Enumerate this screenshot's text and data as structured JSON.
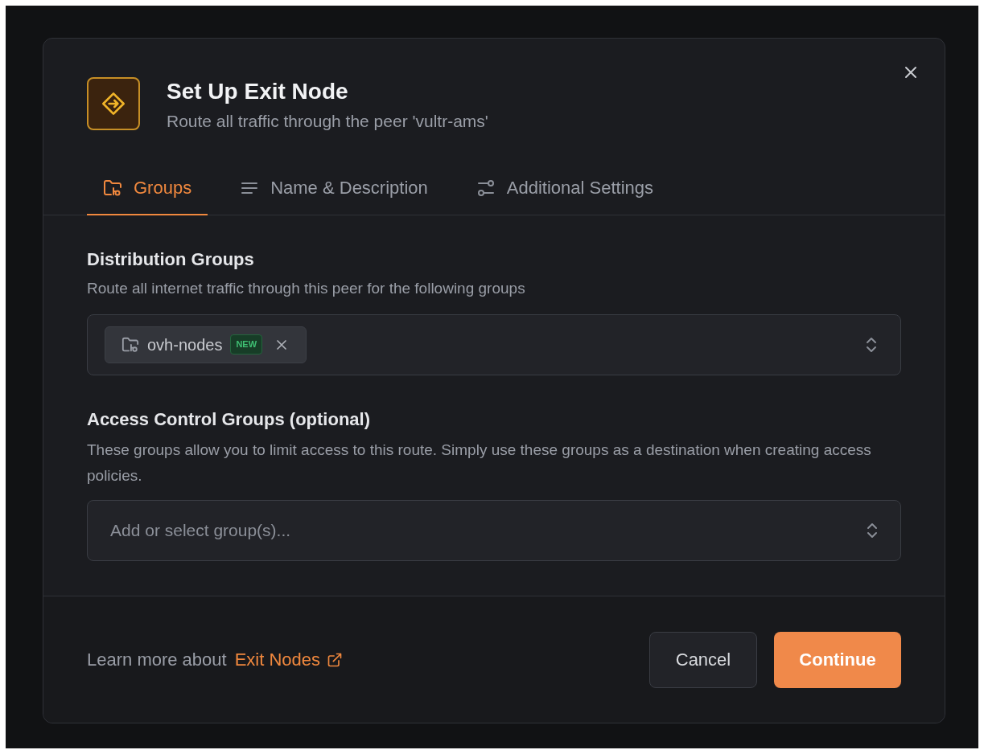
{
  "dialog": {
    "title": "Set Up Exit Node",
    "subtitle": "Route all traffic through the peer 'vultr-ams'"
  },
  "tabs": [
    {
      "label": "Groups",
      "selected": true
    },
    {
      "label": "Name & Description",
      "selected": false
    },
    {
      "label": "Additional Settings",
      "selected": false
    }
  ],
  "distribution_groups": {
    "label": "Distribution Groups",
    "description": "Route all internet traffic through this peer for the following groups",
    "chips": [
      {
        "label": "ovh-nodes",
        "badge": "NEW"
      }
    ]
  },
  "access_control_groups": {
    "label": "Access Control Groups (optional)",
    "description": "These groups allow you to limit access to this route. Simply use these groups as a destination when creating access policies.",
    "placeholder": "Add or select group(s)..."
  },
  "footer": {
    "text": "Learn more about",
    "link": "Exit Nodes",
    "buttons": [
      {
        "label": "Cancel",
        "kind": "secondary"
      },
      {
        "label": "Continue",
        "kind": "primary"
      }
    ]
  }
}
